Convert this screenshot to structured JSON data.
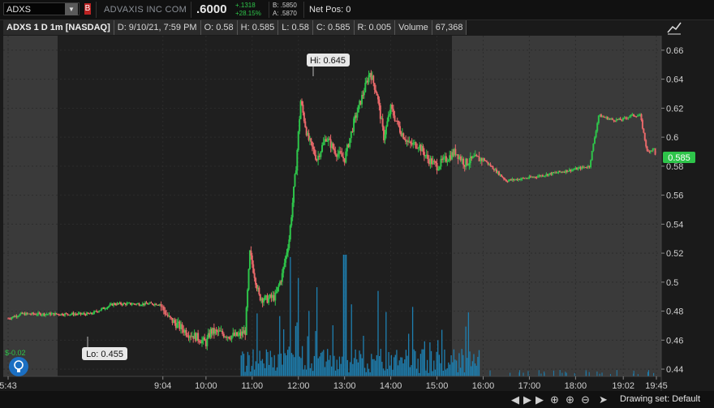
{
  "topbar": {
    "symbol": "ADXS",
    "company": "ADVAXIS INC COM",
    "last": ".6000",
    "change_abs": "+.1318",
    "change_pct": "+28.15%",
    "bid": "B: .5850",
    "ask": "A: .5870",
    "net_pos": "Net Pos: 0",
    "alert_label": "B"
  },
  "infobar": {
    "title": "ADXS 1 D 1m [NASDAQ]",
    "date": "D: 9/10/21, 7:59 PM",
    "open": "O: 0.58",
    "high": "H: 0.585",
    "low": "L: 0.58",
    "close": "C: 0.585",
    "range": "R: 0.005",
    "volume_label": "Volume",
    "volume_value": "67,368"
  },
  "callouts": {
    "hi": "Hi: 0.645",
    "lo": "Lo: 0.455",
    "last_price": "0.585"
  },
  "price_axis": [
    "0.66",
    "0.64",
    "0.62",
    "0.6",
    "0.58",
    "0.56",
    "0.54",
    "0.52",
    "0.5",
    "0.48",
    "0.46",
    "0.44"
  ],
  "time_axis": [
    "5:43",
    "9:04",
    "10:00",
    "11:00",
    "12:00",
    "13:00",
    "14:00",
    "15:00",
    "16:00",
    "17:00",
    "18:00",
    "19:02",
    "19:45"
  ],
  "indicator_text": "$-0.02",
  "statusbar": {
    "drawing_set": "Drawing set: Default"
  },
  "colors": {
    "up": "#2ec44a",
    "down": "#e8686a",
    "volume": "#1e7fb0",
    "session_bg": "#1f1f1f",
    "extended_bg": "#3a3a3a"
  },
  "chart_data": {
    "type": "candlestick",
    "y_range": [
      0.435,
      0.67
    ],
    "time_range": [
      "5:43",
      "19:45"
    ],
    "high": 0.645,
    "low": 0.455,
    "last": 0.585,
    "series_path": [
      [
        5.72,
        0.475
      ],
      [
        6.0,
        0.478
      ],
      [
        6.5,
        0.478
      ],
      [
        7.0,
        0.478
      ],
      [
        7.5,
        0.478
      ],
      [
        8.0,
        0.485
      ],
      [
        8.5,
        0.485
      ],
      [
        9.0,
        0.485
      ],
      [
        9.2,
        0.475
      ],
      [
        9.4,
        0.47
      ],
      [
        9.6,
        0.465
      ],
      [
        9.8,
        0.462
      ],
      [
        10.0,
        0.458
      ],
      [
        10.1,
        0.466
      ],
      [
        10.3,
        0.465
      ],
      [
        10.5,
        0.463
      ],
      [
        10.7,
        0.463
      ],
      [
        10.85,
        0.466
      ],
      [
        10.95,
        0.52
      ],
      [
        11.05,
        0.505
      ],
      [
        11.15,
        0.49
      ],
      [
        11.3,
        0.488
      ],
      [
        11.5,
        0.49
      ],
      [
        11.65,
        0.505
      ],
      [
        11.8,
        0.53
      ],
      [
        11.95,
        0.58
      ],
      [
        12.05,
        0.625
      ],
      [
        12.2,
        0.6
      ],
      [
        12.4,
        0.585
      ],
      [
        12.6,
        0.6
      ],
      [
        12.8,
        0.59
      ],
      [
        13.0,
        0.585
      ],
      [
        13.2,
        0.61
      ],
      [
        13.4,
        0.63
      ],
      [
        13.55,
        0.645
      ],
      [
        13.7,
        0.63
      ],
      [
        13.85,
        0.6
      ],
      [
        14.0,
        0.62
      ],
      [
        14.2,
        0.605
      ],
      [
        14.4,
        0.595
      ],
      [
        14.6,
        0.595
      ],
      [
        14.8,
        0.585
      ],
      [
        15.0,
        0.58
      ],
      [
        15.2,
        0.585
      ],
      [
        15.4,
        0.59
      ],
      [
        15.6,
        0.582
      ],
      [
        15.8,
        0.585
      ],
      [
        16.0,
        0.585
      ],
      [
        16.5,
        0.57
      ],
      [
        17.0,
        0.572
      ],
      [
        17.5,
        0.575
      ],
      [
        18.0,
        0.578
      ],
      [
        18.3,
        0.58
      ],
      [
        18.5,
        0.615
      ],
      [
        18.8,
        0.612
      ],
      [
        19.0,
        0.612
      ],
      [
        19.2,
        0.615
      ],
      [
        19.4,
        0.615
      ],
      [
        19.55,
        0.59
      ],
      [
        19.7,
        0.592
      ],
      [
        19.75,
        0.585
      ]
    ],
    "volume_ticks": 180
  }
}
